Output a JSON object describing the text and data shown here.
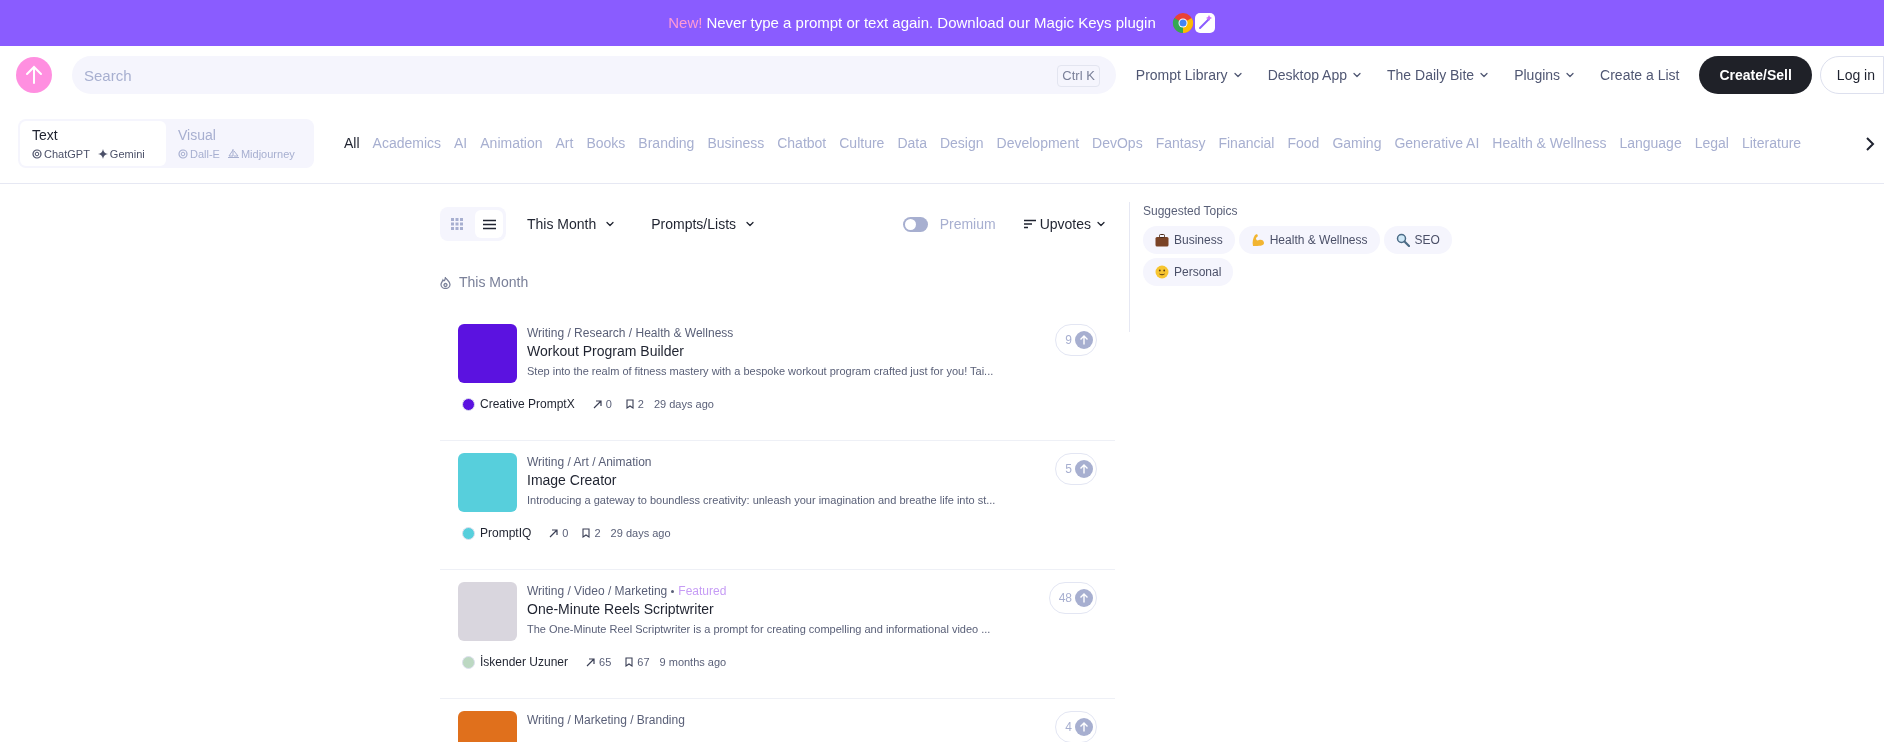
{
  "banner": {
    "badge": "New!",
    "text": "Never type a prompt or text again. Download our Magic Keys plugin"
  },
  "header": {
    "search": {
      "placeholder": "Search",
      "shortcut": "Ctrl K"
    },
    "nav": [
      {
        "label": "Prompt Library",
        "dropdown": true
      },
      {
        "label": "Desktop App",
        "dropdown": true
      },
      {
        "label": "The Daily Bite",
        "dropdown": true
      },
      {
        "label": "Plugins",
        "dropdown": true
      },
      {
        "label": "Create a List",
        "dropdown": false
      }
    ],
    "create_button": "Create/Sell",
    "login_button": "Log in"
  },
  "mode_tabs": [
    {
      "label": "Text",
      "selected": true,
      "models": [
        "ChatGPT",
        "Gemini"
      ]
    },
    {
      "label": "Visual",
      "selected": false,
      "models": [
        "Dall-E",
        "Midjourney"
      ]
    }
  ],
  "categories": [
    {
      "label": "All",
      "selected": true
    },
    {
      "label": "Academics",
      "selected": false
    },
    {
      "label": "AI",
      "selected": false
    },
    {
      "label": "Animation",
      "selected": false
    },
    {
      "label": "Art",
      "selected": false
    },
    {
      "label": "Books",
      "selected": false
    },
    {
      "label": "Branding",
      "selected": false
    },
    {
      "label": "Business",
      "selected": false
    },
    {
      "label": "Chatbot",
      "selected": false
    },
    {
      "label": "Culture",
      "selected": false
    },
    {
      "label": "Data",
      "selected": false
    },
    {
      "label": "Design",
      "selected": false
    },
    {
      "label": "Development",
      "selected": false
    },
    {
      "label": "DevOps",
      "selected": false
    },
    {
      "label": "Fantasy",
      "selected": false
    },
    {
      "label": "Financial",
      "selected": false
    },
    {
      "label": "Food",
      "selected": false
    },
    {
      "label": "Gaming",
      "selected": false
    },
    {
      "label": "Generative AI",
      "selected": false
    },
    {
      "label": "Health & Wellness",
      "selected": false
    },
    {
      "label": "Language",
      "selected": false
    },
    {
      "label": "Legal",
      "selected": false
    },
    {
      "label": "Literature",
      "selected": false
    }
  ],
  "toolbar": {
    "views": [
      {
        "kind": "grid",
        "selected": false
      },
      {
        "kind": "list",
        "selected": true
      }
    ],
    "filters": [
      "This Month",
      "Prompts/Lists"
    ],
    "premium": {
      "label": "Premium",
      "on": false
    },
    "sort": "Upvotes"
  },
  "section_title": "This Month",
  "prompts": [
    {
      "category": "Writing / Research / Health & Wellness",
      "title": "Workout Program Builder",
      "description": "Step into the realm of fitness mastery with a bespoke workout program crafted just for you! Tai...",
      "author": "Creative PromptX",
      "shares": "0",
      "saves": "2",
      "age": "29 days ago",
      "upvotes": "9"
    },
    {
      "category": "Writing / Art / Animation",
      "title": "Image Creator",
      "description": "Introducing a gateway to boundless creativity: unleash your imagination and breathe life into st...",
      "author": "PromptIQ",
      "shares": "0",
      "saves": "2",
      "age": "29 days ago",
      "upvotes": "5"
    },
    {
      "category": "Writing / Video / Marketing",
      "badge": "Featured",
      "title": "One-Minute Reels Scriptwriter",
      "description": "The One-Minute Reel Scriptwriter is a prompt for creating compelling and informational video ...",
      "author": "İskender Uzuner",
      "shares": "65",
      "saves": "67",
      "age": "9 months ago",
      "upvotes": "48"
    },
    {
      "category": "Writing / Marketing / Branding",
      "upvotes": "4"
    }
  ],
  "suggested": {
    "title": "Suggested Topics",
    "topics": [
      {
        "label": "Business",
        "kind": "briefcase"
      },
      {
        "label": "Health & Wellness",
        "kind": "arm"
      },
      {
        "label": "SEO",
        "kind": "magnifier"
      },
      {
        "label": "Personal",
        "kind": "smiley"
      }
    ]
  }
}
